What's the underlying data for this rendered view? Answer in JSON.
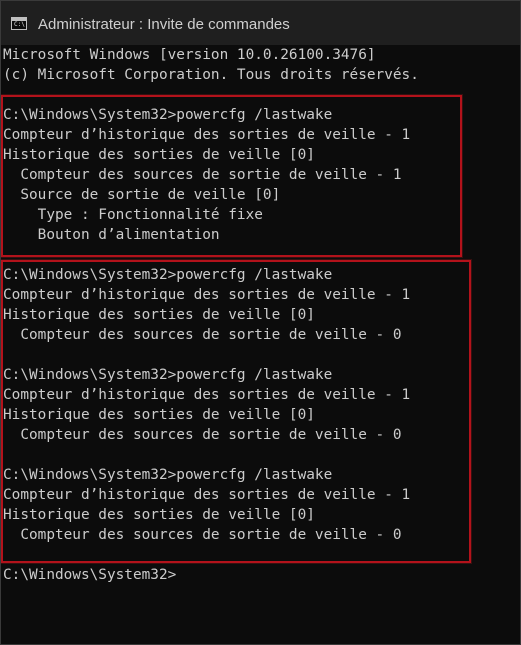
{
  "window": {
    "title": "Administrateur : Invite de commandes"
  },
  "colors": {
    "background": "#0c0c0c",
    "text": "#cccccc",
    "titlebar": "#1f1f1f",
    "highlight_border": "#b3121b"
  },
  "icons": {
    "app_icon": "cmd-icon"
  },
  "console": {
    "lines": [
      "Microsoft Windows [version 10.0.26100.3476]",
      "(c) Microsoft Corporation. Tous droits réservés.",
      "",
      "C:\\Windows\\System32>powercfg /lastwake",
      "Compteur d’historique des sorties de veille - 1",
      "Historique des sorties de veille [0]",
      "  Compteur des sources de sortie de veille - 1",
      "  Source de sortie de veille [0]",
      "    Type : Fonctionnalité fixe",
      "    Bouton d’alimentation",
      "",
      "C:\\Windows\\System32>powercfg /lastwake",
      "Compteur d’historique des sorties de veille - 1",
      "Historique des sorties de veille [0]",
      "  Compteur des sources de sortie de veille - 0",
      "",
      "C:\\Windows\\System32>powercfg /lastwake",
      "Compteur d’historique des sorties de veille - 1",
      "Historique des sorties de veille [0]",
      "  Compteur des sources de sortie de veille - 0",
      "",
      "C:\\Windows\\System32>powercfg /lastwake",
      "Compteur d’historique des sorties de veille - 1",
      "Historique des sorties de veille [0]",
      "  Compteur des sources de sortie de veille - 0",
      "",
      "C:\\Windows\\System32>"
    ]
  }
}
